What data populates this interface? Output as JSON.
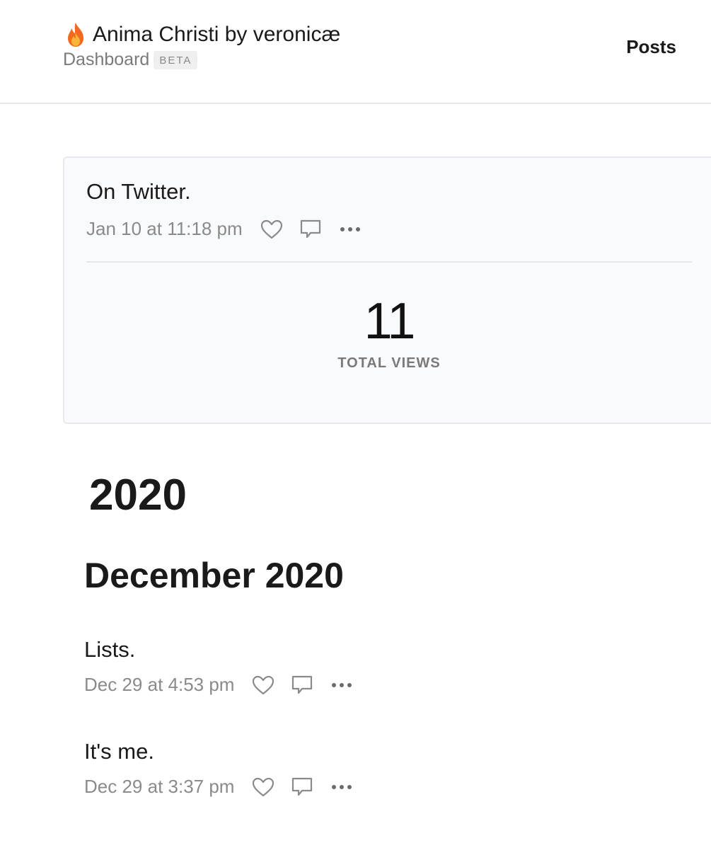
{
  "header": {
    "site_title": "Anima Christi by veronicæ",
    "subtitle": "Dashboard",
    "badge": "BETA",
    "nav_posts": "Posts"
  },
  "featured": {
    "title": "On Twitter.",
    "date": "Jan 10 at 11:18 pm",
    "views": "11",
    "views_label": "TOTAL VIEWS"
  },
  "archive": {
    "year": "2020",
    "month": "December 2020",
    "posts": [
      {
        "title": "Lists.",
        "date": "Dec 29 at 4:53 pm"
      },
      {
        "title": "It's me.",
        "date": "Dec 29 at 3:37 pm"
      }
    ]
  },
  "icons": {
    "flame": "flame-icon",
    "like": "heart-icon",
    "comment": "comment-icon",
    "more": "more-icon"
  }
}
